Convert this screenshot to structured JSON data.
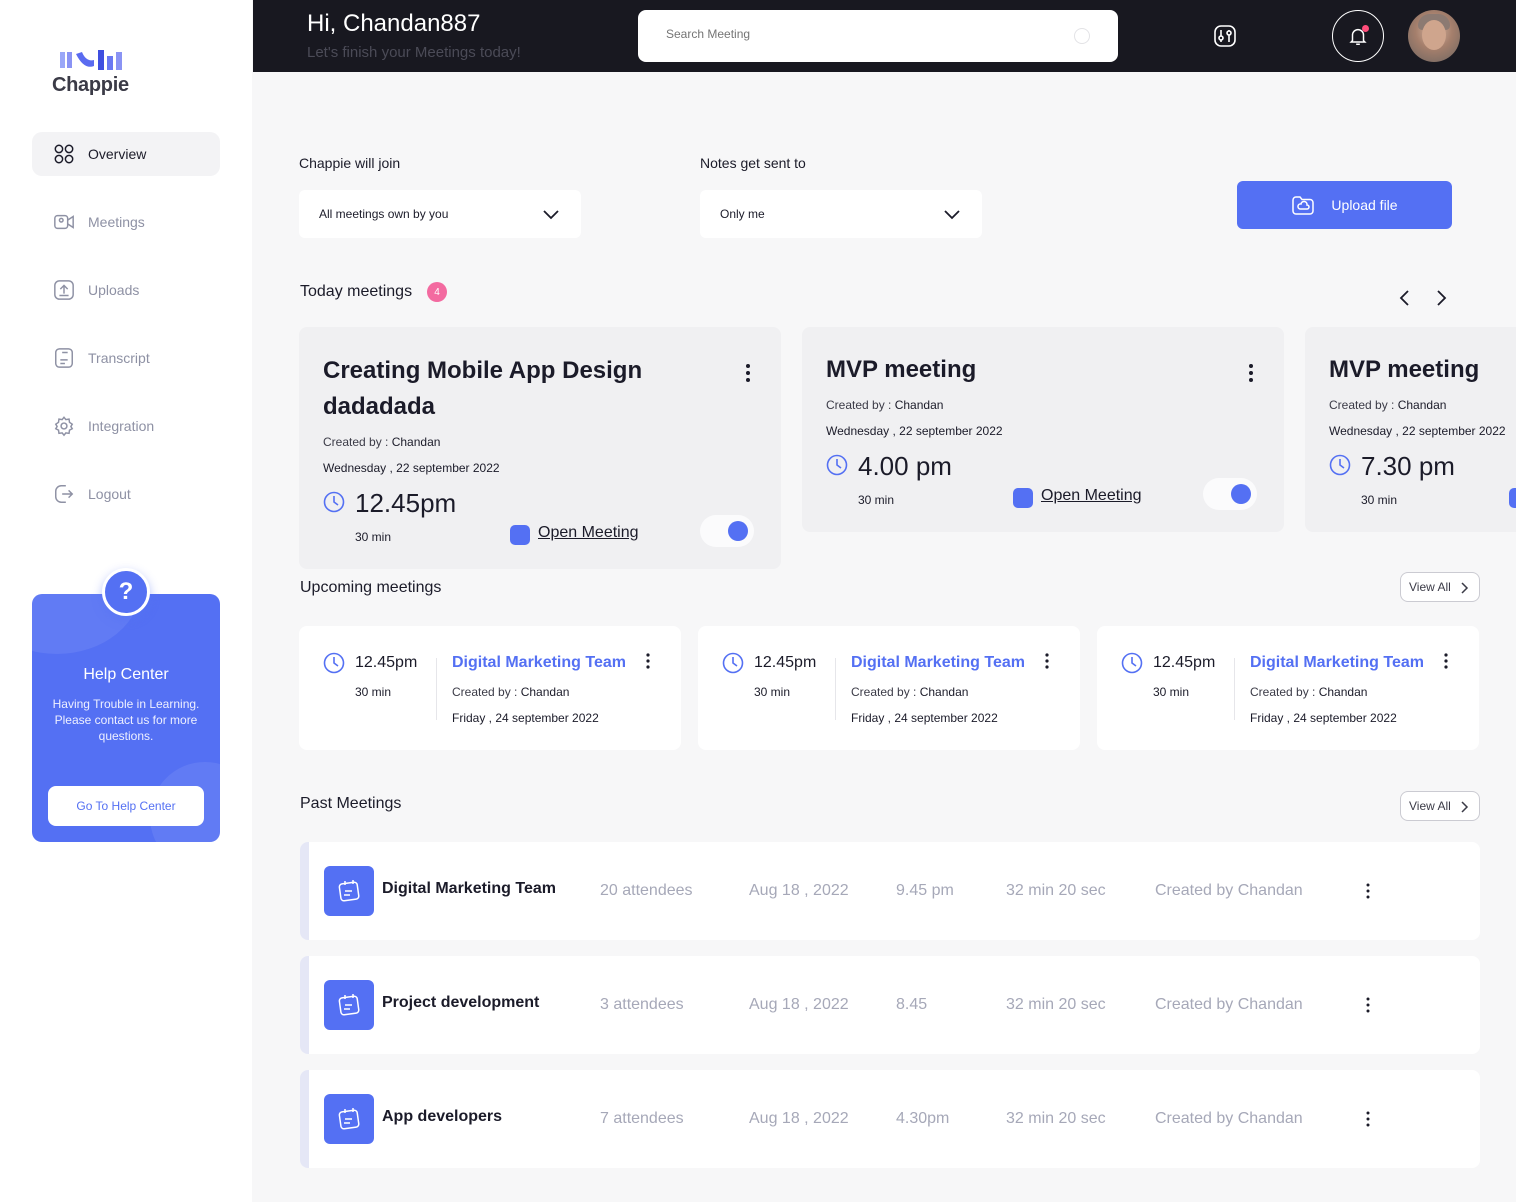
{
  "brand": {
    "name": "Chappie"
  },
  "sidebar": {
    "items": [
      {
        "label": "Overview",
        "icon": "grid-icon",
        "active": true
      },
      {
        "label": "Meetings",
        "icon": "video-icon"
      },
      {
        "label": "Uploads",
        "icon": "upload-icon"
      },
      {
        "label": "Transcript",
        "icon": "document-icon"
      },
      {
        "label": "Integration",
        "icon": "gear-icon"
      },
      {
        "label": "Logout",
        "icon": "logout-icon"
      }
    ],
    "help": {
      "symbol": "?",
      "title": "Help Center",
      "text": "Having Trouble in Learning. Please contact us for more questions.",
      "button": "Go To Help Center"
    }
  },
  "header": {
    "greeting": "Hi, Chandan887",
    "subtitle": "Let's finish your Meetings today!",
    "search_placeholder": "Search Meeting"
  },
  "filters": {
    "join_label": "Chappie will join",
    "join_value": "All meetings own by you",
    "notes_label": "Notes get sent to",
    "notes_value": "Only me",
    "upload_label": "Upload file"
  },
  "today": {
    "title": "Today meetings",
    "count": "4",
    "cards": [
      {
        "title": "Creating Mobile App Design dadadada",
        "created_prefix": "Created by : ",
        "created_by": "Chandan",
        "date": "Wednesday , 22 september 2022",
        "time": "12.45pm",
        "duration": "30 min",
        "open_label": "Open Meeting",
        "toggle_on": true
      },
      {
        "title": "MVP meeting",
        "created_prefix": "Created by : ",
        "created_by": "Chandan",
        "date": "Wednesday , 22 september 2022",
        "time": "4.00 pm",
        "duration": "30 min",
        "open_label": "Open Meeting",
        "toggle_on": true
      },
      {
        "title": "MVP meeting",
        "created_prefix": "Created by : ",
        "created_by": "Chandan",
        "date": "Wednesday , 22 september 2022",
        "time": "7.30 pm",
        "duration": "30 min"
      }
    ]
  },
  "upcoming": {
    "title": "Upcoming meetings",
    "view_all": "View All",
    "cards": [
      {
        "time": "12.45pm",
        "duration": "30 min",
        "name": "Digital Marketing Team",
        "created_prefix": "Created by : ",
        "created_by": "Chandan",
        "date": "Friday , 24 september 2022"
      },
      {
        "time": "12.45pm",
        "duration": "30 min",
        "name": "Digital Marketing Team",
        "created_prefix": "Created by : ",
        "created_by": "Chandan",
        "date": "Friday , 24 september 2022"
      },
      {
        "time": "12.45pm",
        "duration": "30 min",
        "name": "Digital Marketing Team",
        "created_prefix": "Created by : ",
        "created_by": "Chandan",
        "date": "Friday , 24 september 2022"
      }
    ]
  },
  "past": {
    "title": "Past Meetings",
    "view_all": "View All",
    "rows": [
      {
        "name": "Digital Marketing Team",
        "attendees": "20 attendees",
        "date": "Aug 18 , 2022",
        "time": "9.45 pm",
        "length": "32 min 20 sec",
        "creator": "Created by Chandan"
      },
      {
        "name": "Project development",
        "attendees": "3 attendees",
        "date": "Aug 18 , 2022",
        "time": "8.45",
        "length": "32 min 20 sec",
        "creator": "Created by Chandan"
      },
      {
        "name": "App developers",
        "attendees": "7 attendees",
        "date": "Aug 18 , 2022",
        "time": "4.30pm",
        "length": "32 min 20 sec",
        "creator": "Created by Chandan"
      }
    ]
  },
  "colors": {
    "accent": "#5470f3",
    "header_bg": "#181820",
    "badge": "#f36aa0",
    "muted": "#a6a8b8"
  }
}
